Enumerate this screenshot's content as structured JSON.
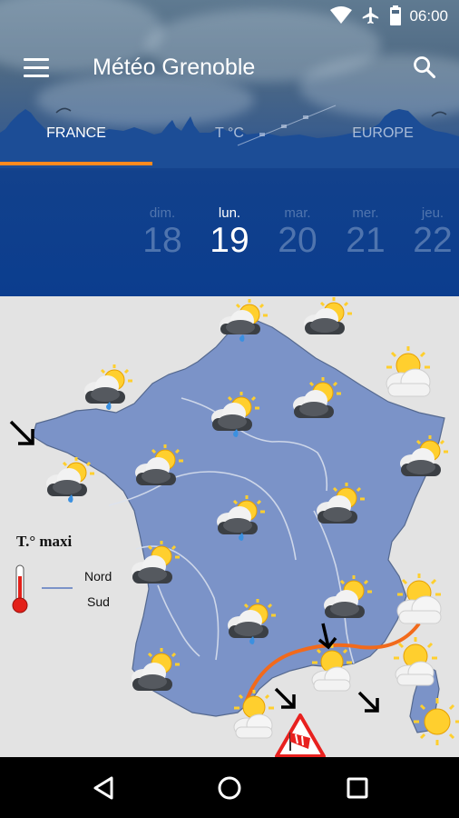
{
  "status_bar": {
    "time": "06:00",
    "icons": [
      "wifi-icon",
      "airplane-icon",
      "battery-icon"
    ]
  },
  "app_bar": {
    "title": "Météo Grenoble",
    "icons": [
      "menu-icon",
      "search-icon"
    ]
  },
  "tabs": [
    {
      "label": "FRANCE",
      "active": true
    },
    {
      "label": "T °C",
      "active": false
    },
    {
      "label": "EUROPE",
      "active": false
    }
  ],
  "days": [
    {
      "name": "dim.",
      "number": "18",
      "active": false
    },
    {
      "name": "lun.",
      "number": "19",
      "active": true
    },
    {
      "name": "mar.",
      "number": "20",
      "active": false
    },
    {
      "name": "mer.",
      "number": "21",
      "active": false
    },
    {
      "name": "jeu.",
      "number": "22",
      "active": false
    }
  ],
  "map": {
    "icons": [
      "partly-cloudy-rain-icon",
      "partly-cloudy-icon",
      "sunny-cloud-icon",
      "sun-icon",
      "wind-arrow-icon",
      "wind-warning-icon"
    ],
    "legend": {
      "title": "T.° maxi",
      "north": "Nord",
      "south": "Sud"
    }
  },
  "nav_bar": {
    "icons": [
      "back-icon",
      "home-icon",
      "recents-icon"
    ]
  },
  "colors": {
    "header_blue": "#0b3d8e",
    "tab_indicator": "#ff8a1e",
    "land": "#7b93c8",
    "sea": "#e3e3e3",
    "storm_line": "#f26a1b"
  }
}
